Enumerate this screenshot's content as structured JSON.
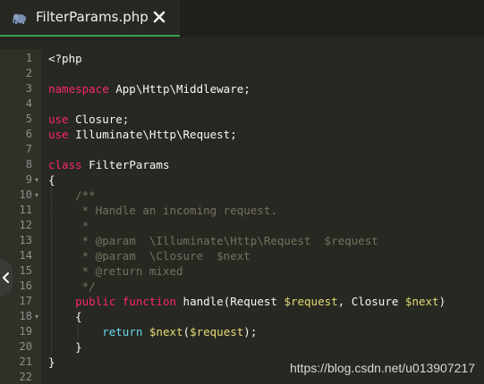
{
  "tab": {
    "title": "FilterParams.php",
    "icon": "php-elephant-icon",
    "close_icon": "close-icon",
    "accent": "#39a04c"
  },
  "editor": {
    "lines": [
      {
        "n": "1",
        "fold": "",
        "code": "<?php"
      },
      {
        "n": "2",
        "fold": "",
        "code": ""
      },
      {
        "n": "3",
        "fold": "",
        "code": "namespace App\\Http\\Middleware;"
      },
      {
        "n": "4",
        "fold": "",
        "code": ""
      },
      {
        "n": "5",
        "fold": "",
        "code": "use Closure;"
      },
      {
        "n": "6",
        "fold": "",
        "code": "use Illuminate\\Http\\Request;"
      },
      {
        "n": "7",
        "fold": "",
        "code": ""
      },
      {
        "n": "8",
        "fold": "",
        "code": "class FilterParams"
      },
      {
        "n": "9",
        "fold": "▾",
        "code": "{"
      },
      {
        "n": "10",
        "fold": "▾",
        "code": "    /**"
      },
      {
        "n": "11",
        "fold": "",
        "code": "     * Handle an incoming request."
      },
      {
        "n": "12",
        "fold": "",
        "code": "     *"
      },
      {
        "n": "13",
        "fold": "",
        "code": "     * @param  \\Illuminate\\Http\\Request  $request"
      },
      {
        "n": "14",
        "fold": "",
        "code": "     * @param  \\Closure  $next"
      },
      {
        "n": "15",
        "fold": "",
        "code": "     * @return mixed"
      },
      {
        "n": "16",
        "fold": "",
        "code": "     */"
      },
      {
        "n": "17",
        "fold": "",
        "code": "    public function handle(Request $request, Closure $next)"
      },
      {
        "n": "18",
        "fold": "▾",
        "code": "    {"
      },
      {
        "n": "19",
        "fold": "",
        "code": "        return $next($request);"
      },
      {
        "n": "20",
        "fold": "",
        "code": "    }"
      },
      {
        "n": "21",
        "fold": "",
        "code": "}"
      },
      {
        "n": "22",
        "fold": "",
        "code": ""
      }
    ]
  },
  "side_handle_icon": "chevron-left-icon",
  "watermark": "https://blog.csdn.net/u013907217",
  "colors": {
    "background": "#272822",
    "keyword": "#f92672",
    "keyword2": "#66d9ef",
    "variable": "#e6db74",
    "comment": "#75715e"
  }
}
